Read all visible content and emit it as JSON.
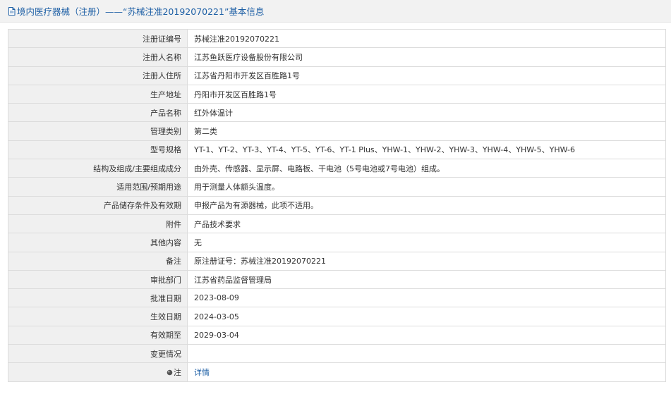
{
  "header": {
    "title": "境内医疗器械（注册）——“苏械注准20192070221”基本信息",
    "icon": "document-icon"
  },
  "rows": [
    {
      "key": "reg_no",
      "label": "注册证编号",
      "value": "苏械注准20192070221"
    },
    {
      "key": "registrant",
      "label": "注册人名称",
      "value": "江苏鱼跃医疗设备股份有限公司"
    },
    {
      "key": "registrant_address",
      "label": "注册人住所",
      "value": "江苏省丹阳市开发区百胜路1号"
    },
    {
      "key": "production_address",
      "label": "生产地址",
      "value": "丹阳市开发区百胜路1号"
    },
    {
      "key": "product_name",
      "label": "产品名称",
      "value": "红外体温计"
    },
    {
      "key": "category",
      "label": "管理类别",
      "value": "第二类"
    },
    {
      "key": "models",
      "label": "型号规格",
      "value": "YT-1、YT-2、YT-3、YT-4、YT-5、YT-6、YT-1 Plus、YHW-1、YHW-2、YHW-3、YHW-4、YHW-5、YHW-6"
    },
    {
      "key": "composition",
      "label": "结构及组成/主要组成成分",
      "value": "由外壳、传感器、显示屏、电路板、干电池（5号电池或7号电池）组成。"
    },
    {
      "key": "intended_use",
      "label": "适用范围/预期用途",
      "value": "用于测量人体额头温度。"
    },
    {
      "key": "storage",
      "label": "产品储存条件及有效期",
      "value": "申报产品为有源器械，此项不适用。"
    },
    {
      "key": "attachment",
      "label": "附件",
      "value": "产品技术要求"
    },
    {
      "key": "other",
      "label": "其他内容",
      "value": "无"
    },
    {
      "key": "remarks",
      "label": "备注",
      "value": "原注册证号：苏械注准20192070221"
    },
    {
      "key": "approval_dept",
      "label": "审批部门",
      "value": "江苏省药品监督管理局"
    },
    {
      "key": "approval_date",
      "label": "批准日期",
      "value": "2023-08-09"
    },
    {
      "key": "effective_date",
      "label": "生效日期",
      "value": "2024-03-05"
    },
    {
      "key": "expiry_date",
      "label": "有效期至",
      "value": "2029-03-04"
    },
    {
      "key": "change_status",
      "label": "变更情况",
      "value": ""
    }
  ],
  "note": {
    "label": "注",
    "link_text": "详情",
    "icon": "note-icon"
  },
  "colors": {
    "link": "#1d5fa5",
    "label_bg": "#f0f0f0",
    "header_bg": "#f2f2f2"
  }
}
